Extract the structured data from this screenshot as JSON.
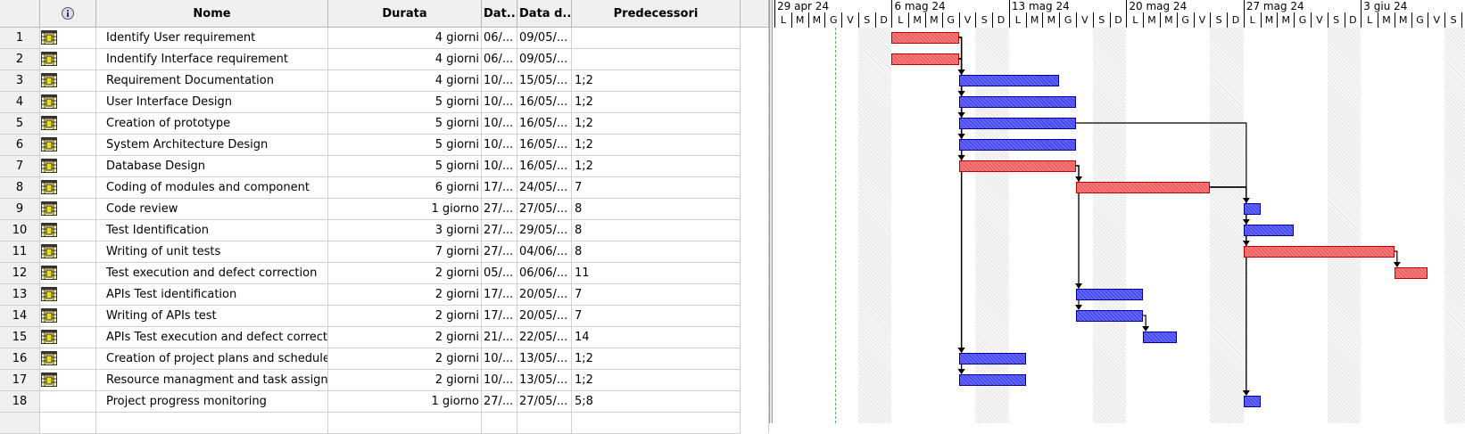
{
  "table": {
    "headers": {
      "num": "",
      "info_icon": "info-icon",
      "name": "Nome",
      "duration": "Durata",
      "start": "Dat...",
      "end": "Data d...",
      "predecessors": "Predecessori"
    },
    "rows": [
      {
        "num": "1",
        "name": "Identify User requirement",
        "duration": "4 giorni",
        "start": "06/...",
        "end": "09/05/...",
        "pred": ""
      },
      {
        "num": "2",
        "name": "Indentify Interface requirement",
        "duration": "4 giorni",
        "start": "06/...",
        "end": "09/05/...",
        "pred": ""
      },
      {
        "num": "3",
        "name": "Requirement Documentation",
        "duration": "4 giorni",
        "start": "10/...",
        "end": "15/05/...",
        "pred": "1;2"
      },
      {
        "num": "4",
        "name": "User Interface Design",
        "duration": "5 giorni",
        "start": "10/...",
        "end": "16/05/...",
        "pred": "1;2"
      },
      {
        "num": "5",
        "name": "Creation of prototype",
        "duration": "5 giorni",
        "start": "10/...",
        "end": "16/05/...",
        "pred": "1;2"
      },
      {
        "num": "6",
        "name": "System Architecture Design",
        "duration": "5 giorni",
        "start": "10/...",
        "end": "16/05/...",
        "pred": "1;2"
      },
      {
        "num": "7",
        "name": "Database Design",
        "duration": "5 giorni",
        "start": "10/...",
        "end": "16/05/...",
        "pred": "1;2"
      },
      {
        "num": "8",
        "name": "Coding of modules and component",
        "duration": "6 giorni",
        "start": "17/...",
        "end": "24/05/...",
        "pred": "7"
      },
      {
        "num": "9",
        "name": "Code review",
        "duration": "1 giorno",
        "start": "27/...",
        "end": "27/05/...",
        "pred": "8"
      },
      {
        "num": "10",
        "name": "Test Identification",
        "duration": "3 giorni",
        "start": "27/...",
        "end": "29/05/...",
        "pred": "8"
      },
      {
        "num": "11",
        "name": "Writing of unit tests",
        "duration": "7 giorni",
        "start": "27/...",
        "end": "04/06/...",
        "pred": "8"
      },
      {
        "num": "12",
        "name": "Test execution and defect correction",
        "duration": "2 giorni",
        "start": "05/...",
        "end": "06/06/...",
        "pred": "11"
      },
      {
        "num": "13",
        "name": "APIs Test identification",
        "duration": "2 giorni",
        "start": "17/...",
        "end": "20/05/...",
        "pred": "7"
      },
      {
        "num": "14",
        "name": "Writing of APIs test",
        "duration": "2 giorni",
        "start": "17/...",
        "end": "20/05/...",
        "pred": "7"
      },
      {
        "num": "15",
        "name": "APIs Test execution and defect correctio",
        "duration": "2 giorni",
        "start": "21/...",
        "end": "22/05/...",
        "pred": "14"
      },
      {
        "num": "16",
        "name": "Creation of project plans and schedules",
        "duration": "2 giorni",
        "start": "10/...",
        "end": "13/05/...",
        "pred": "1;2"
      },
      {
        "num": "17",
        "name": "Resource managment and task assignmer",
        "duration": "2 giorni",
        "start": "10/...",
        "end": "13/05/...",
        "pred": "1;2"
      },
      {
        "num": "18",
        "name": "Project progress monitoring",
        "duration": "1 giorno",
        "start": "27/...",
        "end": "27/05/...",
        "pred": "5;8"
      }
    ]
  },
  "gantt": {
    "weeks": [
      "29 apr 24",
      "6 mag 24",
      "13 mag 24",
      "20 mag 24",
      "27 mag 24",
      "3 giu 24"
    ],
    "day_letters": [
      "L",
      "M",
      "M",
      "G",
      "V",
      "S",
      "D"
    ],
    "colors": {
      "critical": "#f06060",
      "normal": "#4848f0",
      "link": "#000000",
      "today": "#5cb85c"
    },
    "tasks": [
      {
        "row": 1,
        "start": "2024-05-06",
        "days": 4,
        "critical": true
      },
      {
        "row": 2,
        "start": "2024-05-06",
        "days": 4,
        "critical": true
      },
      {
        "row": 3,
        "start": "2024-05-10",
        "days": 4,
        "critical": false
      },
      {
        "row": 4,
        "start": "2024-05-10",
        "days": 5,
        "critical": false
      },
      {
        "row": 5,
        "start": "2024-05-10",
        "days": 5,
        "critical": false
      },
      {
        "row": 6,
        "start": "2024-05-10",
        "days": 5,
        "critical": false
      },
      {
        "row": 7,
        "start": "2024-05-10",
        "days": 5,
        "critical": true
      },
      {
        "row": 8,
        "start": "2024-05-17",
        "days": 6,
        "critical": true
      },
      {
        "row": 9,
        "start": "2024-05-27",
        "days": 1,
        "critical": false
      },
      {
        "row": 10,
        "start": "2024-05-27",
        "days": 3,
        "critical": false
      },
      {
        "row": 11,
        "start": "2024-05-27",
        "days": 7,
        "critical": true
      },
      {
        "row": 12,
        "start": "2024-06-05",
        "days": 2,
        "critical": true
      },
      {
        "row": 13,
        "start": "2024-05-17",
        "days": 2,
        "critical": false
      },
      {
        "row": 14,
        "start": "2024-05-17",
        "days": 2,
        "critical": false
      },
      {
        "row": 15,
        "start": "2024-05-21",
        "days": 2,
        "critical": false
      },
      {
        "row": 16,
        "start": "2024-05-10",
        "days": 2,
        "critical": false
      },
      {
        "row": 17,
        "start": "2024-05-10",
        "days": 2,
        "critical": false
      },
      {
        "row": 18,
        "start": "2024-05-27",
        "days": 1,
        "critical": false
      }
    ]
  }
}
